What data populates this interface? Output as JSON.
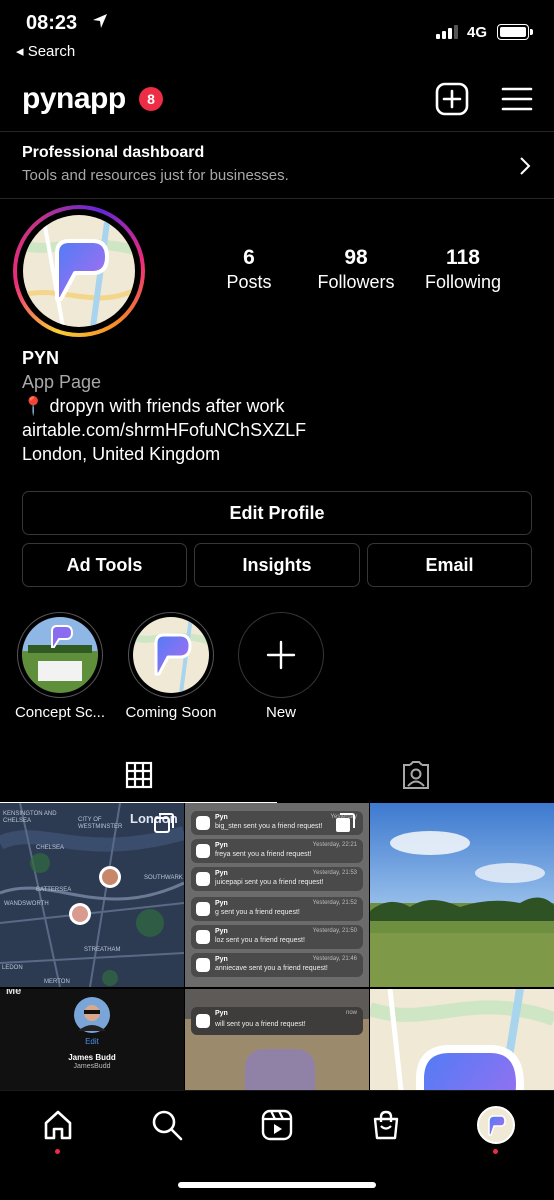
{
  "status_bar": {
    "time": "08:23",
    "back_label": "◂ Search",
    "network": "4G"
  },
  "header": {
    "username": "pynapp",
    "notification_count": "8"
  },
  "dashboard": {
    "title": "Professional dashboard",
    "subtitle": "Tools and resources just for businesses."
  },
  "profile": {
    "stats": [
      {
        "value": "6",
        "label": "Posts"
      },
      {
        "value": "98",
        "label": "Followers"
      },
      {
        "value": "118",
        "label": "Following"
      }
    ],
    "name": "PYN",
    "category": "App Page",
    "bio_pin": "📍",
    "bio_text": "dropyn with friends after work",
    "link": "airtable.com/shrmHFofuNChSXZLF",
    "location": "London, United Kingdom"
  },
  "buttons": {
    "edit_profile": "Edit Profile",
    "ad_tools": "Ad Tools",
    "insights": "Insights",
    "email": "Email"
  },
  "highlights": [
    {
      "label": "Concept Sc..."
    },
    {
      "label": "Coming Soon"
    },
    {
      "label": "New"
    }
  ],
  "grid": {
    "map_label": "London",
    "map_places": [
      "KENSINGTON AND CHELSEA",
      "CITY OF WESTMINSTER",
      "CHELSEA",
      "BATTERSEA",
      "SOUTHWARK",
      "WANDSWORTH",
      "STREATHAM",
      "MERTON",
      "LEDON"
    ],
    "notifications": [
      {
        "app": "Pyn",
        "text": "big_sten sent you a friend request!",
        "time": "Yesterday"
      },
      {
        "app": "Pyn",
        "text": "freya sent you a friend request!",
        "time": "Yesterday, 22:21"
      },
      {
        "app": "Pyn",
        "text": "juicepapi sent you a friend request!",
        "time": "Yesterday, 21:53"
      },
      {
        "app": "Pyn",
        "text": "g sent you a friend request!",
        "time": "Yesterday, 21:52"
      },
      {
        "app": "Pyn",
        "text": "loz sent you a friend request!",
        "time": "Yesterday, 21:50"
      },
      {
        "app": "Pyn",
        "text": "anniecave  sent you a friend request!",
        "time": "Yesterday, 21:46"
      }
    ],
    "lock_notification": {
      "app": "Pyn",
      "text": "will sent you a friend request!",
      "time": "now"
    },
    "me_screen": {
      "heading": "Me",
      "edit": "Edit",
      "name": "James Budd",
      "handle": "JamesBudd"
    }
  },
  "colors": {
    "accent_red": "#ed2c46",
    "border": "#363636",
    "muted": "#a8a8a8"
  }
}
